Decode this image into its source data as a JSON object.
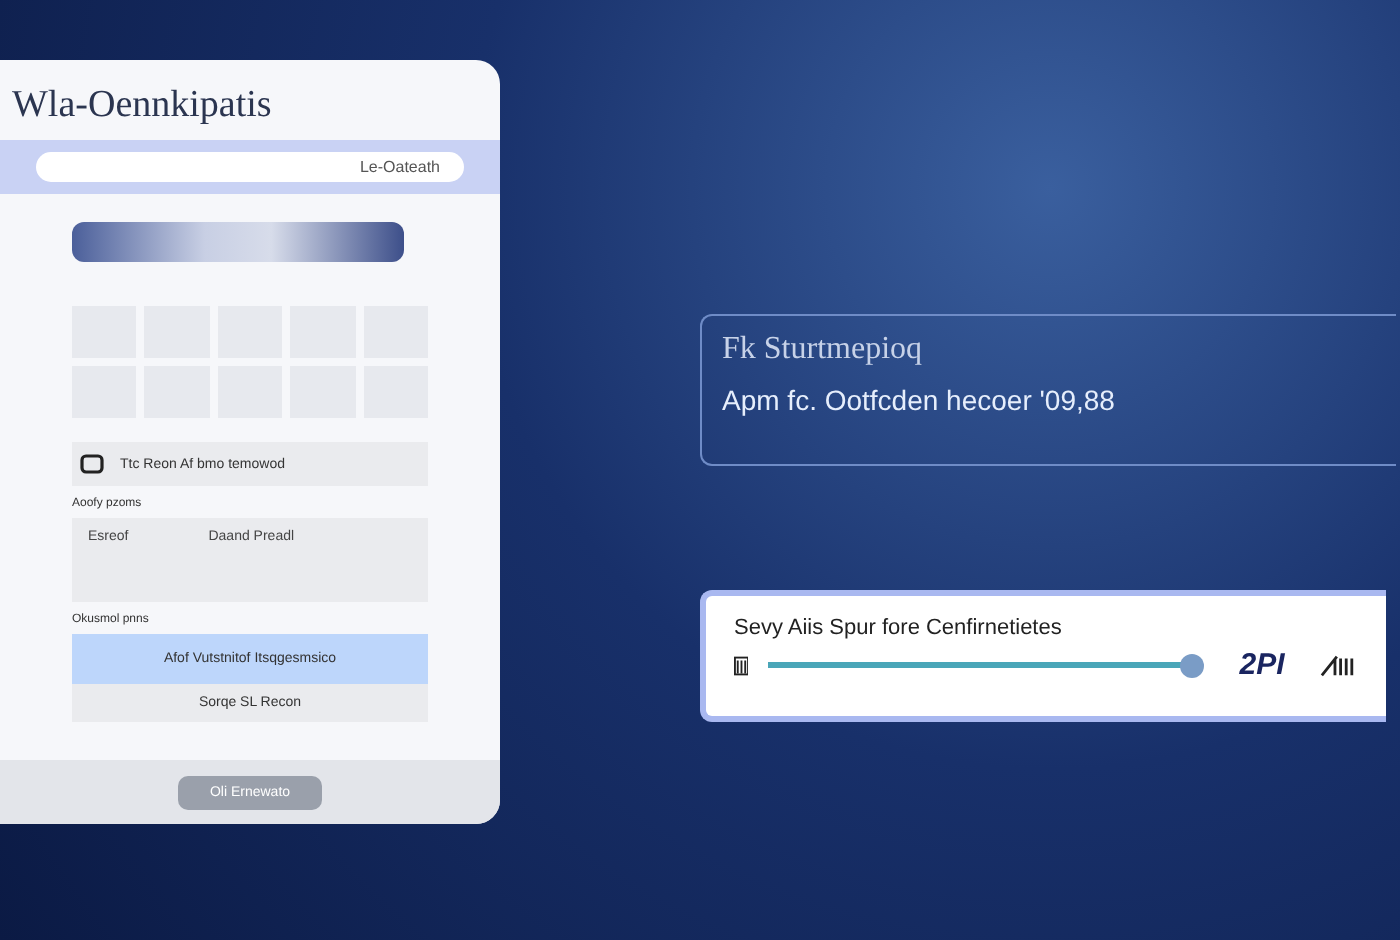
{
  "panel": {
    "title": "Wla-Oennkipatis",
    "search": {
      "value": "Le-Oateath"
    },
    "rows": [
      {
        "kind": "icon-row",
        "text": "Ttc Reon Af bmo temowod"
      }
    ],
    "field_group": {
      "label": "Aoofy pzoms",
      "name": "Esreof",
      "value": "Daand Preadl"
    },
    "options_label": "Okusmol pnns",
    "options": [
      {
        "label": "Afof Vutstnitof Itsqgesmsico",
        "selected": true
      },
      {
        "label": "Sorqe SL Recon",
        "selected": false
      }
    ],
    "button": "Oli Ernewato"
  },
  "info_box": {
    "title": "Fk Sturtmepioq",
    "subtitle": "Apm fc. Ootfcden hecoer '09,88"
  },
  "slider_card": {
    "title": "Sevy Aiis Spur fore Cenfirnetietes",
    "level": 0.92,
    "reading": "2PI"
  }
}
